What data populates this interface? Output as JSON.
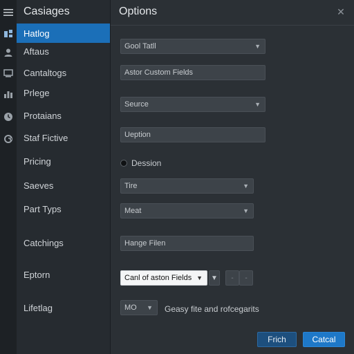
{
  "rail": {
    "icons": [
      "menu-icon",
      "layout-icon",
      "user-icon",
      "monitor-icon",
      "chart-icon",
      "clock-icon",
      "refresh-icon"
    ]
  },
  "sidebar": {
    "title": "Casiages",
    "items": [
      {
        "label": "Hatlog",
        "active": true
      },
      {
        "label": "Aftaus"
      },
      {
        "label": "Cantaltogs"
      },
      {
        "label": "Prlege"
      },
      {
        "label": "Protaians"
      },
      {
        "label": "Staf Fictive"
      },
      {
        "label": "Pricing"
      },
      {
        "label": "Saeves"
      },
      {
        "label": "Part Typs"
      },
      {
        "label": "Catchings"
      },
      {
        "label": "Eptorn"
      },
      {
        "label": "Lifetlag"
      }
    ]
  },
  "main": {
    "title": "Options",
    "close_label": "✕",
    "fields": {
      "goal": "Gool Tatll",
      "custom_fields": "Astor Custom Fields",
      "source": "Seurce",
      "option": "Ueption",
      "radio_label": "Dession",
      "type": "Tire",
      "meat": "Meat",
      "hange": "Hange Filen",
      "custom_select": "Canl of aston Fields",
      "mo": "MO",
      "mo_description": "Geasy fite and rofcegarits"
    },
    "mini_buttons": [
      "-",
      "-"
    ],
    "buttons": {
      "finish": "Frich",
      "cancel": "Catcal"
    }
  },
  "colors": {
    "accent": "#1b6fb8",
    "primary_button": "#1e78c8",
    "background": "#2b3035",
    "sidebar": "#262b30",
    "rail": "#1d2125"
  }
}
